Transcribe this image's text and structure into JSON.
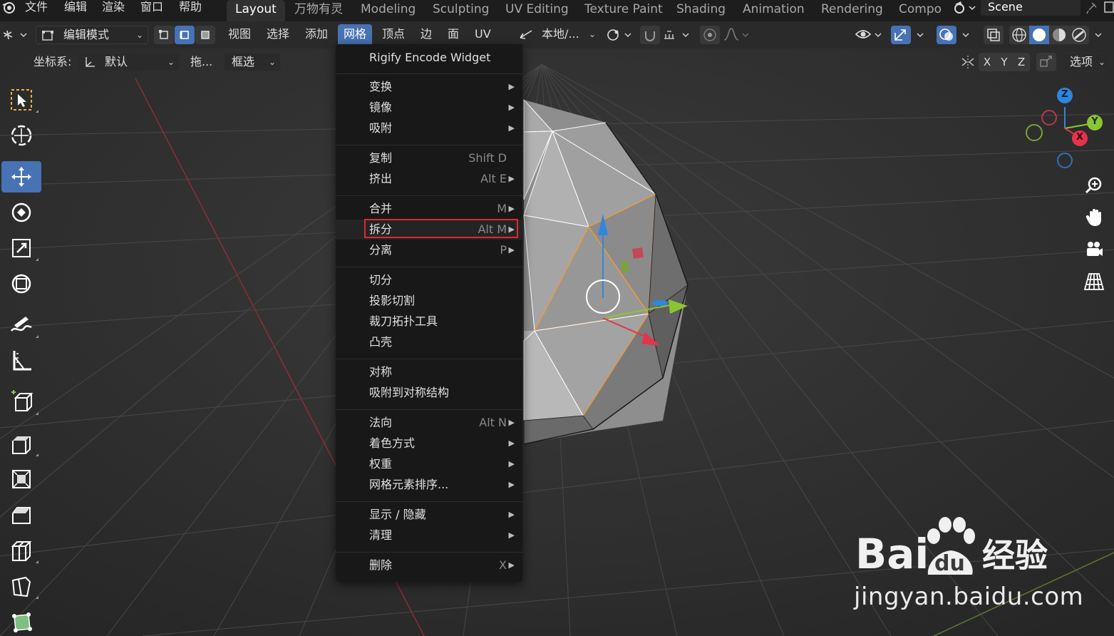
{
  "topbar": {
    "menus": [
      "文件",
      "编辑",
      "渲染",
      "窗口",
      "帮助"
    ],
    "workspaces": [
      "Layout",
      "万物有灵",
      "Modeling",
      "Sculpting",
      "UV Editing",
      "Texture Paint",
      "Shading",
      "Animation",
      "Rendering",
      "Compo"
    ],
    "active_workspace": "Layout",
    "scene_name": "Scene"
  },
  "header": {
    "mode": "编辑模式",
    "menus": [
      "视图",
      "选择",
      "添加",
      "网格",
      "顶点",
      "边",
      "面",
      "UV"
    ],
    "active_menu": "网格",
    "transform_orientation": "本地/...",
    "coord_label": "坐标系:",
    "coord_value": "默认",
    "drag_label": "拖...",
    "select_mode": "框选",
    "axes": [
      "X",
      "Y",
      "Z"
    ],
    "options_label": "选项"
  },
  "mesh_menu": {
    "title": "Rigify Encode Widget",
    "groups": [
      [
        {
          "label": "变换",
          "shortcut": "",
          "submenu": true
        },
        {
          "label": "镜像",
          "shortcut": "",
          "submenu": true
        },
        {
          "label": "吸附",
          "shortcut": "",
          "submenu": true
        }
      ],
      [
        {
          "label": "复制",
          "shortcut": "Shift D",
          "submenu": false
        },
        {
          "label": "挤出",
          "shortcut": "Alt E",
          "submenu": true
        }
      ],
      [
        {
          "label": "合并",
          "shortcut": "M",
          "submenu": true
        },
        {
          "label": "拆分",
          "shortcut": "Alt M",
          "submenu": true,
          "highlighted": true
        },
        {
          "label": "分离",
          "shortcut": "P",
          "submenu": true
        }
      ],
      [
        {
          "label": "切分",
          "shortcut": "",
          "submenu": false
        },
        {
          "label": "投影切割",
          "shortcut": "",
          "submenu": false
        },
        {
          "label": "裁刀拓扑工具",
          "shortcut": "",
          "submenu": false
        },
        {
          "label": "凸壳",
          "shortcut": "",
          "submenu": false
        }
      ],
      [
        {
          "label": "对称",
          "shortcut": "",
          "submenu": false
        },
        {
          "label": "吸附到对称结构",
          "shortcut": "",
          "submenu": false
        }
      ],
      [
        {
          "label": "法向",
          "shortcut": "Alt N",
          "submenu": true
        },
        {
          "label": "着色方式",
          "shortcut": "",
          "submenu": true
        },
        {
          "label": "权重",
          "shortcut": "",
          "submenu": true
        },
        {
          "label": "网格元素排序...",
          "shortcut": "",
          "submenu": true
        }
      ],
      [
        {
          "label": "显示 / 隐藏",
          "shortcut": "",
          "submenu": true
        },
        {
          "label": "清理",
          "shortcut": "",
          "submenu": true
        }
      ],
      [
        {
          "label": "删除",
          "shortcut": "X",
          "submenu": true
        }
      ]
    ]
  },
  "gizmo": {
    "axes": [
      "Z",
      "Y",
      "X"
    ]
  },
  "watermark": {
    "brand_text": "Bai",
    "brand_text2": "du",
    "suffix": "经验",
    "url": "jingyan.baidu.com"
  },
  "colors": {
    "accent": "#4772b3",
    "highlight_border": "#e3262f",
    "axis_x": "#e3344c",
    "axis_y": "#8bc534",
    "axis_z": "#2f86dd"
  }
}
